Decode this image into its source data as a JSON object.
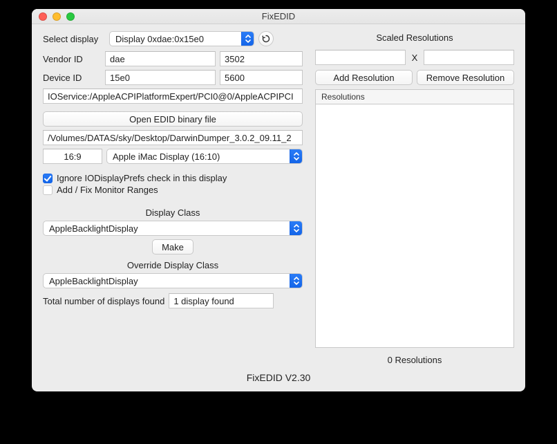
{
  "window": {
    "title": "FixEDID"
  },
  "left": {
    "selectDisplayLabel": "Select display",
    "displayComboValue": "Display 0xdae:0x15e0",
    "refreshIcon": "refresh-icon",
    "vendorLabel": "Vendor ID",
    "vendorHex": "dae",
    "vendorDec": "3502",
    "deviceLabel": "Device ID",
    "deviceHex": "15e0",
    "deviceDec": "5600",
    "ioServicePath": "IOService:/AppleACPIPlatformExpert/PCI0@0/AppleACPIPCI",
    "openEDIDButton": "Open EDID binary file",
    "edidFilePath": "/Volumes/DATAS/sky/Desktop/DarwinDumper_3.0.2_09.11_2",
    "aspectRatio": "16:9",
    "profileComboValue": "Apple iMac Display (16:10)",
    "ignorePrefsLabel": "Ignore IODisplayPrefs check in this display",
    "ignorePrefsChecked": true,
    "addFixRangesLabel": "Add / Fix Monitor Ranges",
    "addFixRangesChecked": false,
    "displayClassLabel": "Display Class",
    "displayClassValue": "AppleBacklightDisplay",
    "makeButton": "Make",
    "overrideDisplayClassLabel": "Override Display Class",
    "overrideDisplayClassValue": "AppleBacklightDisplay",
    "totalDisplaysLabel": "Total number of displays found",
    "totalDisplaysValue": "1 display found"
  },
  "right": {
    "title": "Scaled Resolutions",
    "widthValue": "",
    "heightValue": "",
    "separator": "X",
    "addButton": "Add Resolution",
    "removeButton": "Remove Resolution",
    "tableHeader": "Resolutions",
    "rows": [],
    "countLabel": "0 Resolutions"
  },
  "footer": {
    "version": "FixEDID V2.30"
  }
}
